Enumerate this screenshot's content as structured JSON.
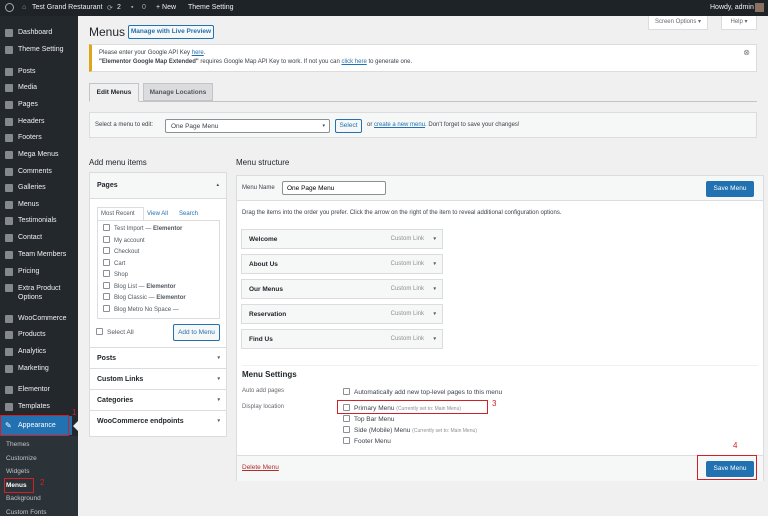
{
  "adminbar": {
    "site": "Test Grand Restaurant",
    "updates": "2",
    "comments": "0",
    "new": "+ New",
    "theme_setting": "Theme Setting",
    "howdy": "Howdy, admin"
  },
  "sidebar": {
    "items": [
      "Dashboard",
      "Theme Setting",
      "Posts",
      "Media",
      "Pages",
      "Headers",
      "Footers",
      "Mega Menus",
      "Comments",
      "Galleries",
      "Menus",
      "Testimonials",
      "Contact",
      "Team Members",
      "Pricing",
      "Extra Product Options",
      "WooCommerce",
      "Products",
      "Analytics",
      "Marketing",
      "Elementor",
      "Templates",
      "Appearance"
    ],
    "submenu": [
      "Themes",
      "Customize",
      "Widgets",
      "Menus",
      "Background",
      "Custom Fonts"
    ],
    "active": "Appearance",
    "active_sub": "Menus"
  },
  "annotations": [
    "1",
    "2",
    "3",
    "4"
  ],
  "header": {
    "title": "Menus",
    "live_preview": "Manage with Live Preview",
    "screen_options": "Screen Options ▾",
    "help": "Help ▾"
  },
  "notice": {
    "line1_pre": "Please enter your Google API Key ",
    "line1_link": "here",
    "line1_post": ".",
    "line2_bold": "\"Elementor Google Map Extended\"",
    "line2_mid": " requires Google Map API Key to work. If not you can ",
    "line2_link": "click here",
    "line2_post": " to generate one."
  },
  "tabs": [
    "Edit Menus",
    "Manage Locations"
  ],
  "select_bar": {
    "label": "Select a menu to edit:",
    "value": "One Page Menu",
    "button": "Select",
    "or": "or",
    "create_link": "create a new menu",
    "suffix": ". Don't forget to save your changes!"
  },
  "add_items": {
    "heading": "Add menu items",
    "pages": "Pages",
    "subtabs": [
      "Most Recent",
      "View All",
      "Search"
    ],
    "pages_list": [
      {
        "name": "Test Import",
        "suffix": "Elementor"
      },
      {
        "name": "My account",
        "suffix": ""
      },
      {
        "name": "Checkout",
        "suffix": ""
      },
      {
        "name": "Cart",
        "suffix": ""
      },
      {
        "name": "Shop",
        "suffix": ""
      },
      {
        "name": "Blog List",
        "suffix": "Elementor"
      },
      {
        "name": "Blog Classic",
        "suffix": "Elementor"
      },
      {
        "name": "Blog Metro No Space",
        "suffix": ""
      }
    ],
    "select_all": "Select All",
    "add_button": "Add to Menu",
    "sections": [
      "Posts",
      "Custom Links",
      "Categories",
      "WooCommerce endpoints"
    ]
  },
  "structure": {
    "heading": "Menu structure",
    "name_label": "Menu Name",
    "name_value": "One Page Menu",
    "save": "Save Menu",
    "instructions": "Drag the items into the order you prefer. Click the arrow on the right of the item to reveal additional configuration options.",
    "items": [
      {
        "title": "Welcome",
        "type": "Custom Link"
      },
      {
        "title": "About Us",
        "type": "Custom Link"
      },
      {
        "title": "Our Menus",
        "type": "Custom Link"
      },
      {
        "title": "Reservation",
        "type": "Custom Link"
      },
      {
        "title": "Find Us",
        "type": "Custom Link"
      }
    ],
    "settings_heading": "Menu Settings",
    "auto_add_label": "Auto add pages",
    "auto_add_option": "Automatically add new top-level pages to this menu",
    "display_label": "Display location",
    "locations": [
      {
        "name": "Primary Menu",
        "note": "(Currently set to: Main Menu)"
      },
      {
        "name": "Top Bar Menu",
        "note": ""
      },
      {
        "name": "Side (Mobile) Menu",
        "note": "(Currently set to: Main Menu)"
      },
      {
        "name": "Footer Menu",
        "note": ""
      }
    ],
    "delete": "Delete Menu"
  }
}
